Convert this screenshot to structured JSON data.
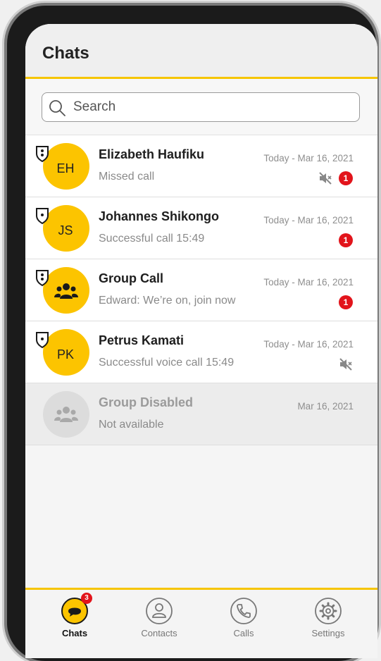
{
  "header": {
    "title": "Chats"
  },
  "search": {
    "placeholder": "Search"
  },
  "chats": [
    {
      "name": "Elizabeth Haufiku",
      "initials": "EH",
      "subtitle": "Missed call",
      "date": "Today - Mar 16, 2021",
      "unread": "1",
      "muted": true,
      "secure": "strong"
    },
    {
      "name": "Johannes Shikongo",
      "initials": "JS",
      "subtitle": "Successful call 15:49",
      "date": "Today - Mar 16, 2021",
      "unread": "1",
      "muted": false,
      "secure": "basic"
    },
    {
      "name": "Group Call",
      "initials": "",
      "subtitle": "Edward: We’re on, join now",
      "date": "Today - Mar 16, 2021",
      "unread": "1",
      "muted": false,
      "secure": "strong"
    },
    {
      "name": "Petrus Kamati",
      "initials": "PK",
      "subtitle": "Successful voice call 15:49",
      "date": "Today - Mar 16, 2021",
      "unread": "",
      "muted": true,
      "secure": "basic"
    },
    {
      "name": "Group Disabled",
      "initials": "",
      "subtitle": "Not available",
      "date": "Mar 16, 2021",
      "unread": "",
      "muted": false,
      "secure": ""
    }
  ],
  "tabs": [
    {
      "label": "Chats",
      "icon": "chat-bubble-icon",
      "badge": "3",
      "active": true
    },
    {
      "label": "Contacts",
      "icon": "person-icon",
      "active": false
    },
    {
      "label": "Calls",
      "icon": "phone-icon",
      "active": false
    },
    {
      "label": "Settings",
      "icon": "gear-icon",
      "active": false
    }
  ],
  "colors": {
    "accent": "#fcc400",
    "badge": "#e2141b"
  }
}
